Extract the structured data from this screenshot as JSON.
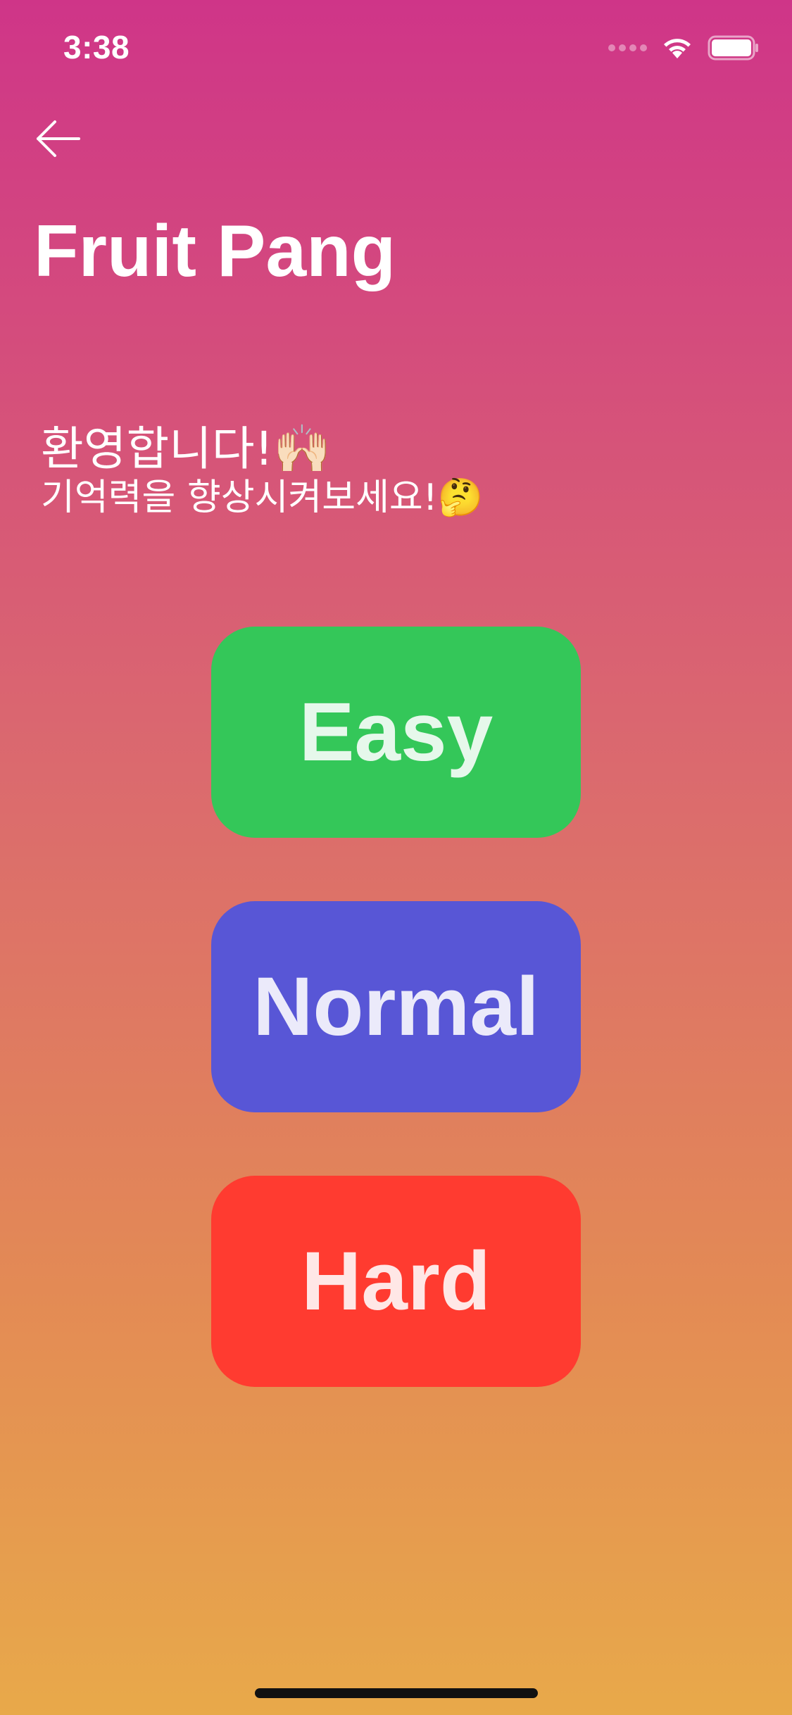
{
  "status_bar": {
    "time": "3:38"
  },
  "nav": {
    "back_icon": "back-arrow-icon"
  },
  "title": "Fruit Pang",
  "welcome": {
    "line1_text": "환영합니다!",
    "line1_emoji": "🙌🏻",
    "line2_text": "기억력을 향상시켜보세요!",
    "line2_emoji": "🤔"
  },
  "levels": {
    "easy": {
      "label": "Easy",
      "color": "#34c759"
    },
    "normal": {
      "label": "Normal",
      "color": "#5856d6"
    },
    "hard": {
      "label": "Hard",
      "color": "#ff3b30"
    }
  },
  "colors": {
    "gradient_top": "#cf3588",
    "gradient_bottom": "#e8a94a"
  }
}
